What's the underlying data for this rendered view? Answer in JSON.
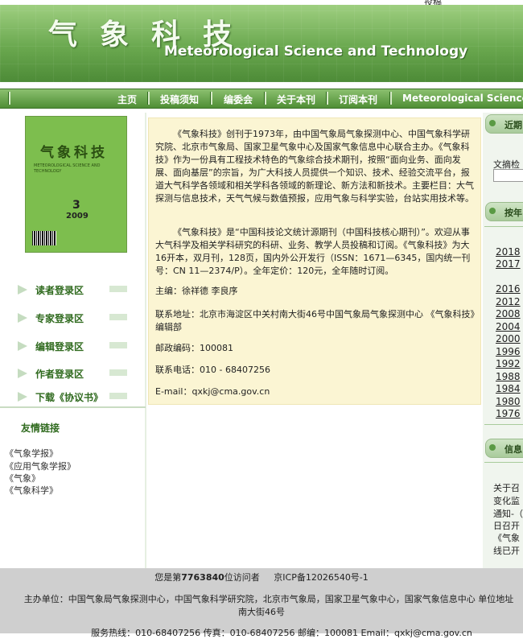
{
  "top": {
    "link_fragment": "投稿"
  },
  "banner": {
    "title_cn": "气象科技",
    "title_en": "Meteorological Science and Technology"
  },
  "nav": {
    "items": [
      "主页",
      "投稿须知",
      "编委会",
      "关于本刊",
      "订阅本刊",
      "Meteorological Science and Technology"
    ]
  },
  "cover": {
    "title": "气象科技",
    "subtitle": "METEOROLOGICAL SCIENCE AND TECHNOLOGY",
    "issue": "3",
    "year": "2009"
  },
  "left_menu": {
    "items": [
      "读者登录区",
      "专家登录区",
      "编辑登录区",
      "作者登录区",
      "下载《协议书》"
    ]
  },
  "friends": {
    "title": "友情链接",
    "links": [
      "《气象学报》",
      "《应用气象学报》",
      "《气象》",
      "《气象科学》"
    ]
  },
  "content": {
    "para1": "《气象科技》创刊于1973年，由中国气象局气象探测中心、中国气象科学研究院、北京市气象局、国家卫星气象中心及国家气象信息中心联合主办。《气象科技》作为一份具有工程技术特色的气象综合技术期刊，按照“面向业务、面向发展、面向基层”的宗旨，为广大科技人员提供一个知识、技术、经验交流平台，报道大气科学各领域和相关学科各领域的新理论、新方法和新技术。主要栏目：大气探测与信息技术，天气气候与数值预报，应用气象与科学实验，台站实用技术等。",
    "para2": "《气象科技》是“中国科技论文统计源期刊（中国科技核心期刊）”。欢迎从事大气科学及相关学科研究的科研、业务、教学人员投稿和订阅。《气象科技》为大16开本，双月刊，128页，国内外公开发行（ISSN：1671—6345，国内统一刊号：CN 11—2374/P）。全年定价：120元，全年随时订阅。",
    "editor": "主编：徐祥德  李良序",
    "address": "联系地址：北京市海淀区中关村南大街46号中国气象局气象探测中心 《气象科技》编辑部",
    "postcode": "邮政编码：100081",
    "phone": "联系电话：010 - 68407256",
    "email": "E-mail：qxkj@cma.gov.cn"
  },
  "right": {
    "panel1_title": "近期",
    "search_label": "文摘检",
    "panel2_title": "按年",
    "years": [
      "2018",
      "2017",
      "2016",
      "2012",
      "2008",
      "2004",
      "2000",
      "1996",
      "1992",
      "1988",
      "1984",
      "1980",
      "1976"
    ],
    "panel3_title": "信息",
    "news_lines": [
      "关于召",
      "变化监",
      "通知-（",
      "日召开",
      "《气象",
      "线已开"
    ]
  },
  "footer": {
    "visitors_prefix": "您是第",
    "visitors_count": "7763840",
    "visitors_suffix": "位访问者",
    "icp": "京ICP备12026540号-1",
    "sponsors": "主办单位：中国气象局气象探测中心，中国气象科学研究院，北京市气象局，国家卫星气象中心，国家气象信息中心    单位地址",
    "address_tail": "南大街46号",
    "contact": "服务热线：010-68407256      传真：010-68407256      邮编：100081      Email：qxkj@cma.gov.cn"
  }
}
